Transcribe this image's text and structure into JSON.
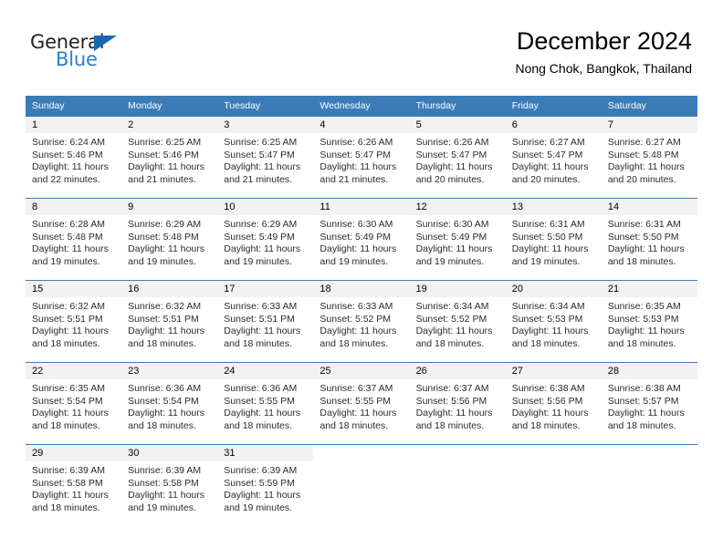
{
  "brand": {
    "name_part1": "General",
    "name_part2": "Blue",
    "triangle_icon": "triangle-icon",
    "colors": {
      "dark": "#231f20",
      "blue": "#2a7fc9",
      "triangle": "#1668b3"
    }
  },
  "header": {
    "title": "December 2024",
    "subtitle": "Nong Chok, Bangkok, Thailand"
  },
  "calendar": {
    "accent_color": "#3b7cb8",
    "daynum_background": "#f2f2f2",
    "weekday_headers": [
      "Sunday",
      "Monday",
      "Tuesday",
      "Wednesday",
      "Thursday",
      "Friday",
      "Saturday"
    ],
    "weeks": [
      [
        {
          "day": "1",
          "sunrise": "Sunrise: 6:24 AM",
          "sunset": "Sunset: 5:46 PM",
          "daylight": "Daylight: 11 hours and 22 minutes."
        },
        {
          "day": "2",
          "sunrise": "Sunrise: 6:25 AM",
          "sunset": "Sunset: 5:46 PM",
          "daylight": "Daylight: 11 hours and 21 minutes."
        },
        {
          "day": "3",
          "sunrise": "Sunrise: 6:25 AM",
          "sunset": "Sunset: 5:47 PM",
          "daylight": "Daylight: 11 hours and 21 minutes."
        },
        {
          "day": "4",
          "sunrise": "Sunrise: 6:26 AM",
          "sunset": "Sunset: 5:47 PM",
          "daylight": "Daylight: 11 hours and 21 minutes."
        },
        {
          "day": "5",
          "sunrise": "Sunrise: 6:26 AM",
          "sunset": "Sunset: 5:47 PM",
          "daylight": "Daylight: 11 hours and 20 minutes."
        },
        {
          "day": "6",
          "sunrise": "Sunrise: 6:27 AM",
          "sunset": "Sunset: 5:47 PM",
          "daylight": "Daylight: 11 hours and 20 minutes."
        },
        {
          "day": "7",
          "sunrise": "Sunrise: 6:27 AM",
          "sunset": "Sunset: 5:48 PM",
          "daylight": "Daylight: 11 hours and 20 minutes."
        }
      ],
      [
        {
          "day": "8",
          "sunrise": "Sunrise: 6:28 AM",
          "sunset": "Sunset: 5:48 PM",
          "daylight": "Daylight: 11 hours and 19 minutes."
        },
        {
          "day": "9",
          "sunrise": "Sunrise: 6:29 AM",
          "sunset": "Sunset: 5:48 PM",
          "daylight": "Daylight: 11 hours and 19 minutes."
        },
        {
          "day": "10",
          "sunrise": "Sunrise: 6:29 AM",
          "sunset": "Sunset: 5:49 PM",
          "daylight": "Daylight: 11 hours and 19 minutes."
        },
        {
          "day": "11",
          "sunrise": "Sunrise: 6:30 AM",
          "sunset": "Sunset: 5:49 PM",
          "daylight": "Daylight: 11 hours and 19 minutes."
        },
        {
          "day": "12",
          "sunrise": "Sunrise: 6:30 AM",
          "sunset": "Sunset: 5:49 PM",
          "daylight": "Daylight: 11 hours and 19 minutes."
        },
        {
          "day": "13",
          "sunrise": "Sunrise: 6:31 AM",
          "sunset": "Sunset: 5:50 PM",
          "daylight": "Daylight: 11 hours and 19 minutes."
        },
        {
          "day": "14",
          "sunrise": "Sunrise: 6:31 AM",
          "sunset": "Sunset: 5:50 PM",
          "daylight": "Daylight: 11 hours and 18 minutes."
        }
      ],
      [
        {
          "day": "15",
          "sunrise": "Sunrise: 6:32 AM",
          "sunset": "Sunset: 5:51 PM",
          "daylight": "Daylight: 11 hours and 18 minutes."
        },
        {
          "day": "16",
          "sunrise": "Sunrise: 6:32 AM",
          "sunset": "Sunset: 5:51 PM",
          "daylight": "Daylight: 11 hours and 18 minutes."
        },
        {
          "day": "17",
          "sunrise": "Sunrise: 6:33 AM",
          "sunset": "Sunset: 5:51 PM",
          "daylight": "Daylight: 11 hours and 18 minutes."
        },
        {
          "day": "18",
          "sunrise": "Sunrise: 6:33 AM",
          "sunset": "Sunset: 5:52 PM",
          "daylight": "Daylight: 11 hours and 18 minutes."
        },
        {
          "day": "19",
          "sunrise": "Sunrise: 6:34 AM",
          "sunset": "Sunset: 5:52 PM",
          "daylight": "Daylight: 11 hours and 18 minutes."
        },
        {
          "day": "20",
          "sunrise": "Sunrise: 6:34 AM",
          "sunset": "Sunset: 5:53 PM",
          "daylight": "Daylight: 11 hours and 18 minutes."
        },
        {
          "day": "21",
          "sunrise": "Sunrise: 6:35 AM",
          "sunset": "Sunset: 5:53 PM",
          "daylight": "Daylight: 11 hours and 18 minutes."
        }
      ],
      [
        {
          "day": "22",
          "sunrise": "Sunrise: 6:35 AM",
          "sunset": "Sunset: 5:54 PM",
          "daylight": "Daylight: 11 hours and 18 minutes."
        },
        {
          "day": "23",
          "sunrise": "Sunrise: 6:36 AM",
          "sunset": "Sunset: 5:54 PM",
          "daylight": "Daylight: 11 hours and 18 minutes."
        },
        {
          "day": "24",
          "sunrise": "Sunrise: 6:36 AM",
          "sunset": "Sunset: 5:55 PM",
          "daylight": "Daylight: 11 hours and 18 minutes."
        },
        {
          "day": "25",
          "sunrise": "Sunrise: 6:37 AM",
          "sunset": "Sunset: 5:55 PM",
          "daylight": "Daylight: 11 hours and 18 minutes."
        },
        {
          "day": "26",
          "sunrise": "Sunrise: 6:37 AM",
          "sunset": "Sunset: 5:56 PM",
          "daylight": "Daylight: 11 hours and 18 minutes."
        },
        {
          "day": "27",
          "sunrise": "Sunrise: 6:38 AM",
          "sunset": "Sunset: 5:56 PM",
          "daylight": "Daylight: 11 hours and 18 minutes."
        },
        {
          "day": "28",
          "sunrise": "Sunrise: 6:38 AM",
          "sunset": "Sunset: 5:57 PM",
          "daylight": "Daylight: 11 hours and 18 minutes."
        }
      ],
      [
        {
          "day": "29",
          "sunrise": "Sunrise: 6:39 AM",
          "sunset": "Sunset: 5:58 PM",
          "daylight": "Daylight: 11 hours and 18 minutes."
        },
        {
          "day": "30",
          "sunrise": "Sunrise: 6:39 AM",
          "sunset": "Sunset: 5:58 PM",
          "daylight": "Daylight: 11 hours and 19 minutes."
        },
        {
          "day": "31",
          "sunrise": "Sunrise: 6:39 AM",
          "sunset": "Sunset: 5:59 PM",
          "daylight": "Daylight: 11 hours and 19 minutes."
        },
        {
          "day": "",
          "sunrise": "",
          "sunset": "",
          "daylight": ""
        },
        {
          "day": "",
          "sunrise": "",
          "sunset": "",
          "daylight": ""
        },
        {
          "day": "",
          "sunrise": "",
          "sunset": "",
          "daylight": ""
        },
        {
          "day": "",
          "sunrise": "",
          "sunset": "",
          "daylight": ""
        }
      ]
    ]
  }
}
